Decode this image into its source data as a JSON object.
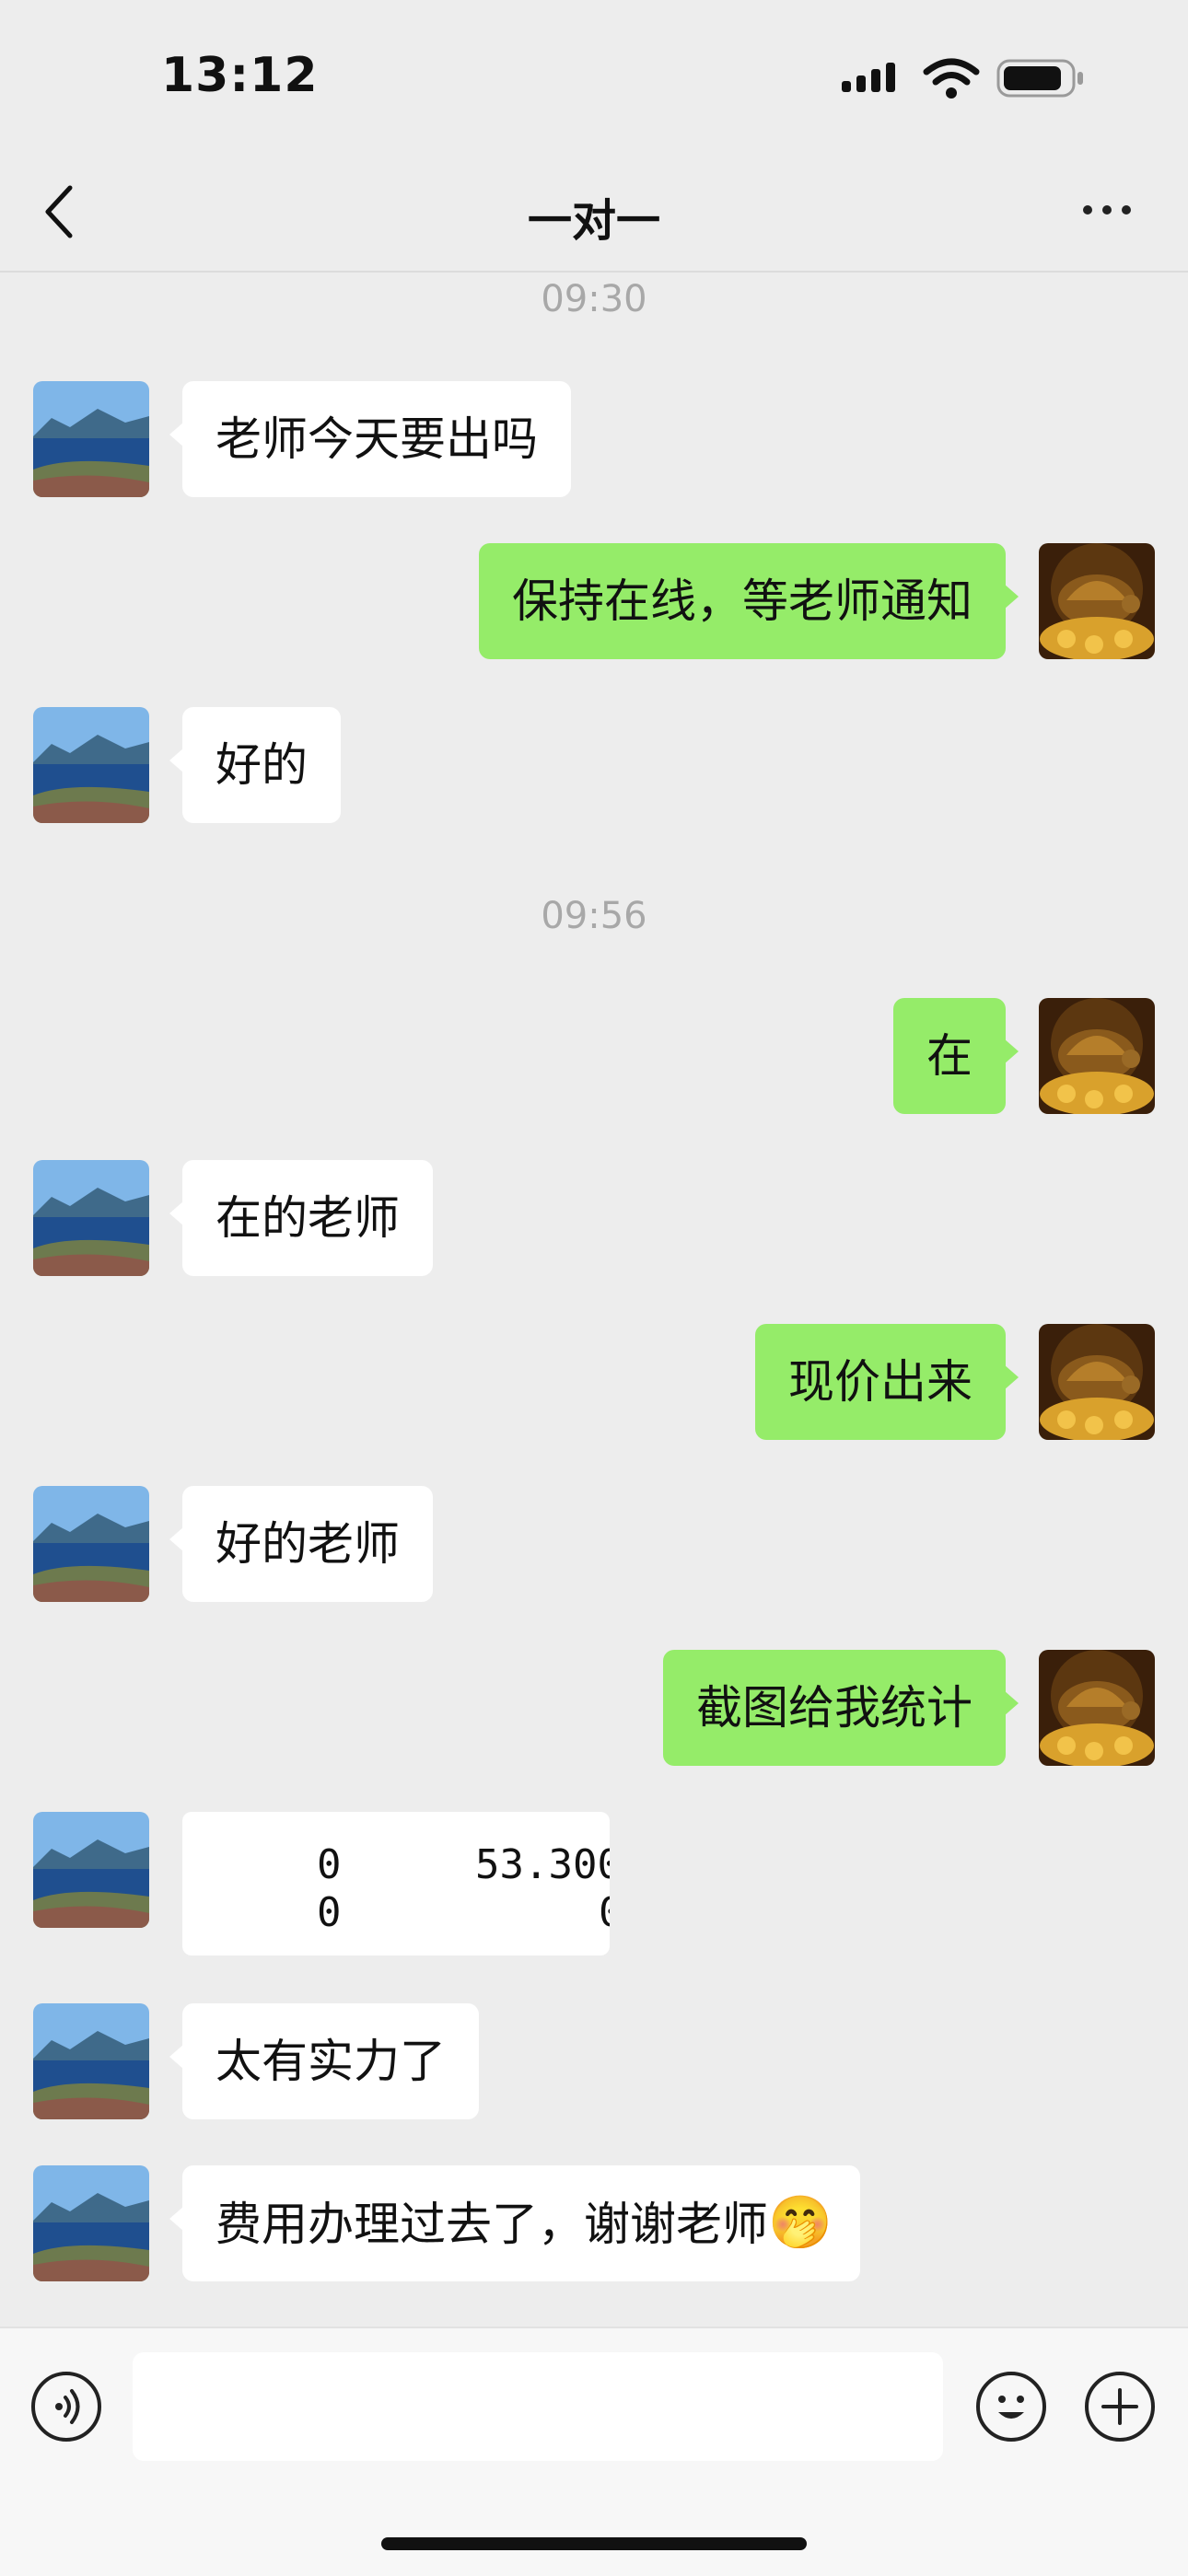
{
  "status_bar": {
    "time": "13:12"
  },
  "nav": {
    "title": "一对一"
  },
  "timestamps": [
    "09:30",
    "09:56"
  ],
  "messages": [
    {
      "side": "in",
      "text": "老师今天要出吗"
    },
    {
      "side": "out",
      "text": "保持在线，等老师通知"
    },
    {
      "side": "in",
      "text": "好的"
    },
    {
      "side": "out",
      "text": "在"
    },
    {
      "side": "in",
      "text": "在的老师"
    },
    {
      "side": "out",
      "text": "现价出来"
    },
    {
      "side": "in",
      "text": "好的老师"
    },
    {
      "side": "out",
      "text": "截图给我统计"
    },
    {
      "side": "in",
      "text": "太有实力了"
    },
    {
      "side": "in",
      "text": "费用办理过去了，谢谢老师"
    }
  ],
  "image_message": {
    "row1": [
      "0",
      "53.300"
    ],
    "row2": [
      "0",
      "0"
    ]
  },
  "emoji": "🤭",
  "input": {
    "placeholder": ""
  },
  "colors": {
    "background": "#ededed",
    "incoming": "#ffffff",
    "outgoing": "#95ec69"
  }
}
